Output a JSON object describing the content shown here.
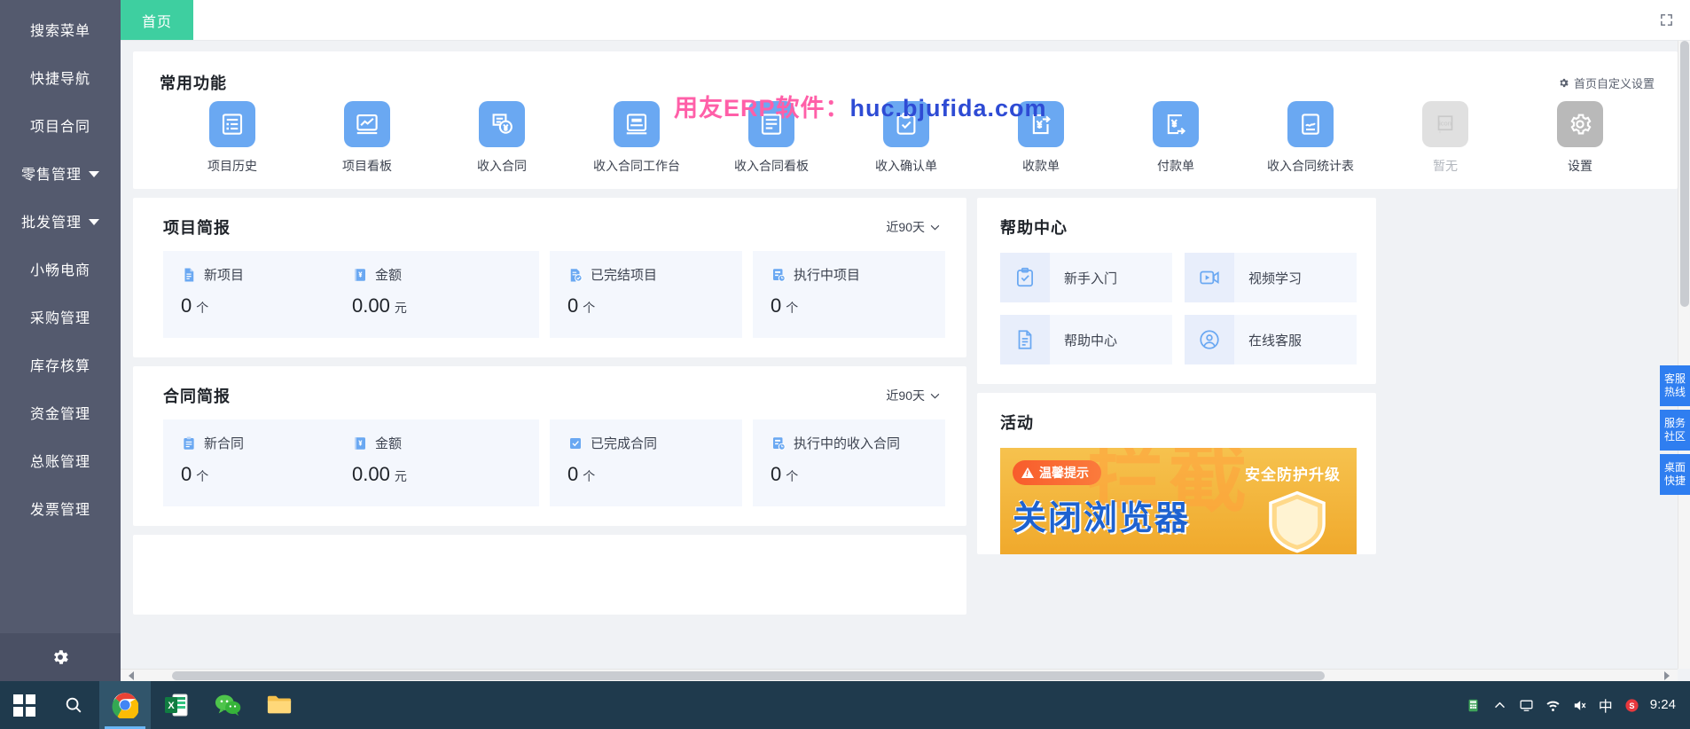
{
  "sidebar": {
    "items": [
      {
        "label": "搜索菜单",
        "has_caret": false
      },
      {
        "label": "快捷导航",
        "has_caret": false
      },
      {
        "label": "项目合同",
        "has_caret": false
      },
      {
        "label": "零售管理",
        "has_caret": true
      },
      {
        "label": "批发管理",
        "has_caret": true
      },
      {
        "label": "小畅电商",
        "has_caret": false
      },
      {
        "label": "采购管理",
        "has_caret": false
      },
      {
        "label": "库存核算",
        "has_caret": false
      },
      {
        "label": "资金管理",
        "has_caret": false
      },
      {
        "label": "总账管理",
        "has_caret": false
      },
      {
        "label": "发票管理",
        "has_caret": false
      }
    ],
    "bottom_icon": "gear-icon",
    "bg_color": "#545a6e"
  },
  "tabbar": {
    "tabs": [
      {
        "label": "首页",
        "active": true
      }
    ],
    "active_color": "#3ecfa0",
    "expand_icon": "fullscreen-icon"
  },
  "watermark": {
    "pink_text": "用友ERP软件：",
    "blue_text": "huc.bjufida.com"
  },
  "common_functions": {
    "title": "常用功能",
    "customize_label": "首页自定义设置",
    "customize_icon": "gear-icon",
    "items": [
      {
        "label": "项目历史",
        "icon": "list-document-icon",
        "state": "normal"
      },
      {
        "label": "项目看板",
        "icon": "chart-board-icon",
        "state": "normal"
      },
      {
        "label": "收入合同",
        "icon": "contract-yuan-icon",
        "state": "normal"
      },
      {
        "label": "收入合同工作台",
        "icon": "workbench-icon",
        "state": "normal"
      },
      {
        "label": "收入合同看板",
        "icon": "board-lines-icon",
        "state": "normal"
      },
      {
        "label": "收入确认单",
        "icon": "clipboard-check-icon",
        "state": "normal"
      },
      {
        "label": "收款单",
        "icon": "receipt-in-icon",
        "state": "normal"
      },
      {
        "label": "付款单",
        "icon": "payment-out-icon",
        "state": "normal"
      },
      {
        "label": "收入合同统计表",
        "icon": "report-chart-icon",
        "state": "normal"
      },
      {
        "label": "暂无",
        "icon": "placeholder-icon",
        "state": "empty"
      },
      {
        "label": "设置",
        "icon": "gear-icon",
        "state": "settings"
      }
    ]
  },
  "project_brief": {
    "title": "项目简报",
    "period": "近90天",
    "stats": [
      {
        "name": "新项目",
        "icon": "document-icon",
        "value": "0",
        "unit": "个"
      },
      {
        "name": "金额",
        "icon": "money-icon",
        "value": "0.00",
        "unit": "元"
      },
      {
        "name": "已完结项目",
        "icon": "doc-check-icon",
        "value": "0",
        "unit": "个"
      },
      {
        "name": "执行中项目",
        "icon": "doc-clock-icon",
        "value": "0",
        "unit": "个"
      }
    ]
  },
  "contract_brief": {
    "title": "合同简报",
    "period": "近90天",
    "stats": [
      {
        "name": "新合同",
        "icon": "clipboard-icon",
        "value": "0",
        "unit": "个"
      },
      {
        "name": "金额",
        "icon": "money-icon",
        "value": "0.00",
        "unit": "元"
      },
      {
        "name": "已完成合同",
        "icon": "check-box-icon",
        "value": "0",
        "unit": "个"
      },
      {
        "name": "执行中的收入合同",
        "icon": "doc-clock-icon",
        "value": "0",
        "unit": "个"
      }
    ]
  },
  "help_center": {
    "title": "帮助中心",
    "items": [
      {
        "label": "新手入门",
        "icon": "clipboard-check-icon"
      },
      {
        "label": "视频学习",
        "icon": "video-play-icon"
      },
      {
        "label": "帮助中心",
        "icon": "document-lines-icon"
      },
      {
        "label": "在线客服",
        "icon": "headset-person-icon"
      }
    ]
  },
  "activity": {
    "title": "活动",
    "banner": {
      "tip_label": "温馨提示",
      "tip_icon": "warning-icon",
      "right_text": "安全防护升级",
      "headline": "关闭浏览器",
      "ghost_text": "拦截",
      "shield_icon": "shield-icon"
    }
  },
  "float_tabs": [
    {
      "line1": "客服",
      "line2": "热线"
    },
    {
      "line1": "服务",
      "line2": "社区"
    },
    {
      "line1": "桌面",
      "line2": "快捷"
    }
  ],
  "taskbar": {
    "start_icon": "windows-logo-icon",
    "search_icon": "search-icon",
    "apps": [
      {
        "name": "chrome-icon",
        "active": true
      },
      {
        "name": "excel-icon",
        "active": false
      },
      {
        "name": "wechat-icon",
        "active": false
      },
      {
        "name": "folder-icon",
        "active": false
      }
    ],
    "tray": [
      {
        "name": "calculator-icon"
      },
      {
        "name": "chevron-up-icon"
      },
      {
        "name": "monitor-icon"
      },
      {
        "name": "network-icon"
      },
      {
        "name": "volume-icon"
      },
      {
        "name": "ime-icon",
        "label": "中"
      },
      {
        "name": "sogou-icon",
        "label": "S"
      }
    ],
    "clock_time": "9:24"
  },
  "colors": {
    "accent_blue": "#6aa8f2",
    "tab_green": "#3ecfa0",
    "sidebar": "#545a6e",
    "stat_bg": "#f4f7fd",
    "float_tab": "#2f7ef0"
  }
}
